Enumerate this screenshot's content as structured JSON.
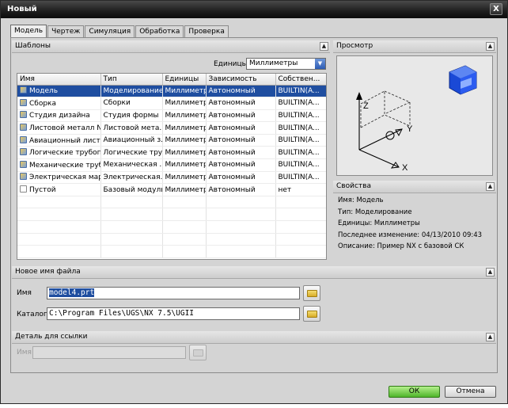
{
  "window": {
    "title": "Новый",
    "close_glyph": "X"
  },
  "tabs": [
    {
      "label": "Модель",
      "active": true
    },
    {
      "label": "Чертеж"
    },
    {
      "label": "Симуляция"
    },
    {
      "label": "Обработка"
    },
    {
      "label": "Проверка"
    }
  ],
  "templates": {
    "header": "Шаблоны",
    "units_label": "Единицы",
    "units_value": "Миллиметры",
    "columns": [
      "Имя",
      "Тип",
      "Единицы",
      "Зависимость",
      "Собствен..."
    ],
    "rows": [
      {
        "name": "Модель",
        "type": "Моделирование",
        "units": "Миллиметр...",
        "dependency": "Автономный",
        "owner": "BUILTIN(A...",
        "selected": true
      },
      {
        "name": "Сборка",
        "type": "Сборки",
        "units": "Миллиметр...",
        "dependency": "Автономный",
        "owner": "BUILTIN(A..."
      },
      {
        "name": "Студия дизайна",
        "type": "Студия формы",
        "units": "Миллиметр...",
        "dependency": "Автономный",
        "owner": "BUILTIN(A..."
      },
      {
        "name": "Листовой металл NX",
        "type": "Листовой мета...",
        "units": "Миллиметр...",
        "dependency": "Автономный",
        "owner": "BUILTIN(A..."
      },
      {
        "name": "Авиационный лист...",
        "type": "Авиационный з...",
        "units": "Миллиметр...",
        "dependency": "Автономный",
        "owner": "BUILTIN(A..."
      },
      {
        "name": "Логические трубоп...",
        "type": "Логические тру...",
        "units": "Миллиметр...",
        "dependency": "Автономный",
        "owner": "BUILTIN(A..."
      },
      {
        "name": "Механические труб...",
        "type": "Механическая ...",
        "units": "Миллиметр...",
        "dependency": "Автономный",
        "owner": "BUILTIN(A..."
      },
      {
        "name": "Электрическая мар...",
        "type": "Электрическая...",
        "units": "Миллиметр...",
        "dependency": "Автономный",
        "owner": "BUILTIN(A..."
      },
      {
        "name": "Пустой",
        "type": "Базовый модуль",
        "units": "Миллиметр...",
        "dependency": "Автономный",
        "owner": "нет"
      }
    ]
  },
  "preview": {
    "header": "Просмотр",
    "axis_z": "Z",
    "axis_y": "Y",
    "axis_x": "X"
  },
  "properties": {
    "header": "Свойства",
    "name_line": "Имя: Модель",
    "type_line": "Тип: Моделирование",
    "units_line": "Единицы: Миллиметры",
    "modified_line": "Последнее изменение: 04/13/2010 09:43",
    "description_line": "Описание: Пример NX с базовой СК"
  },
  "new_file": {
    "header": "Новое имя файла",
    "name_label": "Имя",
    "name_value": "model4.prt",
    "folder_label": "Каталог",
    "folder_value": "C:\\Program Files\\UGS\\NX 7.5\\UGII"
  },
  "reference": {
    "header": "Деталь для ссылки",
    "name_label": "Имя",
    "name_value": ""
  },
  "buttons": {
    "ok": "ОК",
    "cancel": "Отмена"
  },
  "icons": {
    "collapse": "chevron-up-icon",
    "folder": "folder-open-icon",
    "part": "part-template-icon"
  }
}
